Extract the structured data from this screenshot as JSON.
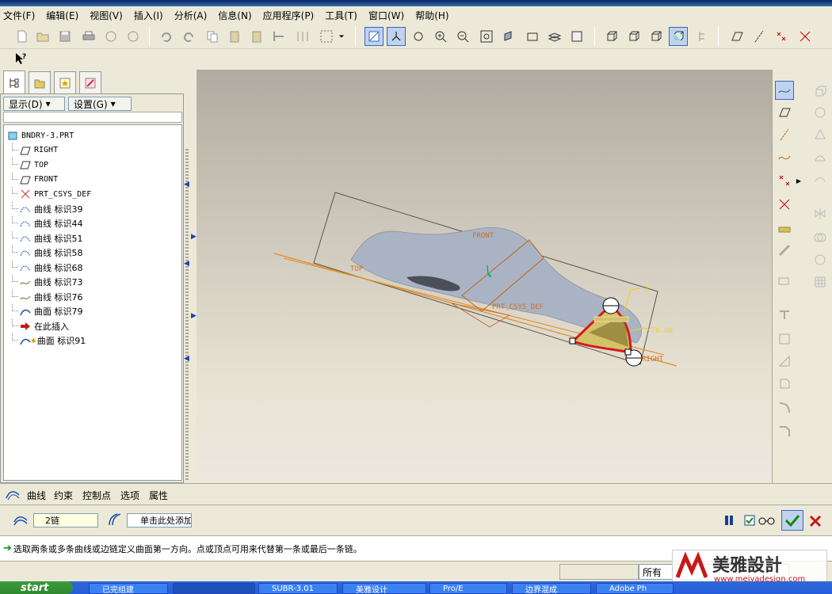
{
  "menu": [
    "文件(F)",
    "编辑(E)",
    "视图(V)",
    "插入(I)",
    "分析(A)",
    "信息(N)",
    "应用程序(P)",
    "工具(T)",
    "窗口(W)",
    "帮助(H)"
  ],
  "left_panel": {
    "show_label": "显示(D)",
    "settings_label": "设置(G)",
    "tree": [
      {
        "label": "BNDRY-3.PRT",
        "icon": "part-icon",
        "mono": true
      },
      {
        "label": "RIGHT",
        "icon": "datum-plane-icon",
        "mono": true
      },
      {
        "label": "TOP",
        "icon": "datum-plane-icon",
        "mono": true
      },
      {
        "label": "FRONT",
        "icon": "datum-plane-icon",
        "mono": true
      },
      {
        "label": "PRT_CSYS_DEF",
        "icon": "csys-icon",
        "mono": true
      },
      {
        "label": "曲线 标识39",
        "icon": "datum-curve-icon"
      },
      {
        "label": "曲线 标识44",
        "icon": "datum-curve-icon"
      },
      {
        "label": "曲线 标识51",
        "icon": "datum-curve-icon"
      },
      {
        "label": "曲线 标识58",
        "icon": "datum-curve-icon"
      },
      {
        "label": "曲线 标识68",
        "icon": "datum-curve-icon"
      },
      {
        "label": "曲线 标识73",
        "icon": "sketch-curve-icon"
      },
      {
        "label": "曲线 标识76",
        "icon": "sketch-curve-icon"
      },
      {
        "label": "曲面 标识79",
        "icon": "surface-icon"
      },
      {
        "label": "在此插入",
        "icon": "insert-arrow-icon"
      },
      {
        "label": "曲面 标识91",
        "icon": "surface-new-icon"
      }
    ]
  },
  "viewport": {
    "labels": {
      "front": "FRONT",
      "top": "TOP",
      "csys": "PRT_CSYS_DEF",
      "dim_z": "Z",
      "dim_val": "T0.00",
      "right": "RIGHT"
    }
  },
  "dashboard": {
    "tabs": [
      "曲线",
      "约束",
      "控制点",
      "选项",
      "属性"
    ],
    "first_dir_value": "2链",
    "second_dir_value": "单击此处添加"
  },
  "message": "选取两条或多条曲线或边链定义曲面第一方向。点或顶点可用来代替第一条或最后一条链。",
  "status": {
    "filter": "所有"
  },
  "taskbar": {
    "start": "start",
    "tasks": [
      "已完组建",
      "",
      "SUBR-3.01",
      "美雅设计",
      "Pro/E",
      "边界混成",
      "Adobe Ph"
    ]
  },
  "watermark": {
    "brand": "美雅設計",
    "url": "www.meiyadesign.com"
  },
  "colors": {
    "viewport_bg": "#cfc9bd",
    "accent_orange": "#e08a1e",
    "surface": "#aab3c4",
    "boundary": "#d51b1b",
    "dim_yellow": "#f0d020"
  }
}
